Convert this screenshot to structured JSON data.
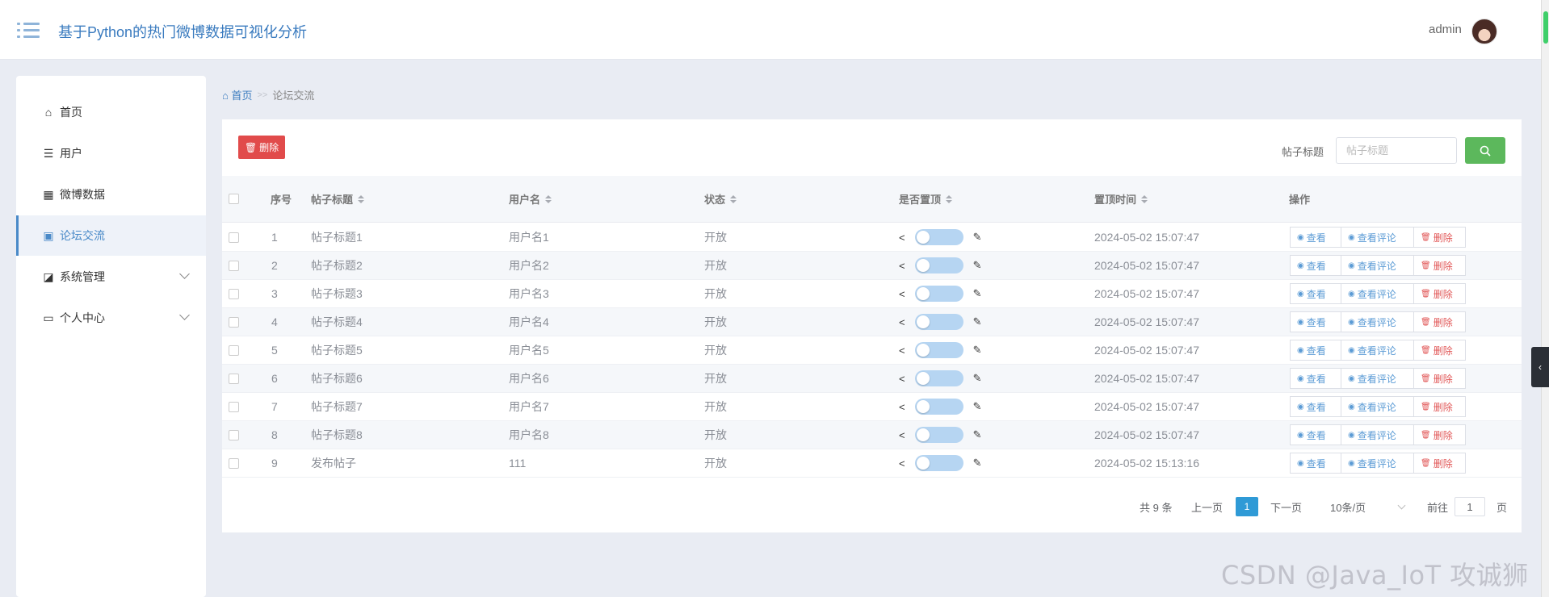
{
  "header": {
    "title": "基于Python的热门微博数据可视化分析",
    "user": "admin"
  },
  "sidebar": {
    "items": [
      {
        "label": "首页",
        "icon": "home-icon",
        "glyph": "⌂"
      },
      {
        "label": "用户",
        "icon": "sliders-icon",
        "glyph": "☰"
      },
      {
        "label": "微博数据",
        "icon": "grid-icon",
        "glyph": "▦"
      },
      {
        "label": "论坛交流",
        "icon": "clipboard-icon",
        "glyph": "▣"
      },
      {
        "label": "系统管理",
        "icon": "chart-icon",
        "glyph": "◪"
      },
      {
        "label": "个人中心",
        "icon": "wallet-icon",
        "glyph": "▭"
      }
    ],
    "active_index": 3
  },
  "breadcrumb": {
    "home": "首页",
    "sep": ">>",
    "current": "论坛交流"
  },
  "toolbar": {
    "delete_label": "删除",
    "search_label": "帖子标题",
    "search_placeholder": "帖子标题",
    "search_value": ""
  },
  "table": {
    "headers": {
      "index": "序号",
      "title": "帖子标题",
      "user": "用户名",
      "status": "状态",
      "pinned": "是否置顶",
      "pin_time": "置顶时间",
      "actions": "操作"
    },
    "rows": [
      {
        "index": "1",
        "title": "帖子标题1",
        "user": "用户名1",
        "status": "开放",
        "pinned": false,
        "pin_time": "2024-05-02 15:07:47"
      },
      {
        "index": "2",
        "title": "帖子标题2",
        "user": "用户名2",
        "status": "开放",
        "pinned": false,
        "pin_time": "2024-05-02 15:07:47"
      },
      {
        "index": "3",
        "title": "帖子标题3",
        "user": "用户名3",
        "status": "开放",
        "pinned": false,
        "pin_time": "2024-05-02 15:07:47"
      },
      {
        "index": "4",
        "title": "帖子标题4",
        "user": "用户名4",
        "status": "开放",
        "pinned": false,
        "pin_time": "2024-05-02 15:07:47"
      },
      {
        "index": "5",
        "title": "帖子标题5",
        "user": "用户名5",
        "status": "开放",
        "pinned": false,
        "pin_time": "2024-05-02 15:07:47"
      },
      {
        "index": "6",
        "title": "帖子标题6",
        "user": "用户名6",
        "status": "开放",
        "pinned": false,
        "pin_time": "2024-05-02 15:07:47"
      },
      {
        "index": "7",
        "title": "帖子标题7",
        "user": "用户名7",
        "status": "开放",
        "pinned": false,
        "pin_time": "2024-05-02 15:07:47"
      },
      {
        "index": "8",
        "title": "帖子标题8",
        "user": "用户名8",
        "status": "开放",
        "pinned": false,
        "pin_time": "2024-05-02 15:07:47"
      },
      {
        "index": "9",
        "title": "发布帖子",
        "user": "111",
        "status": "开放",
        "pinned": false,
        "pin_time": "2024-05-02 15:13:16"
      }
    ],
    "action_labels": {
      "view": "查看",
      "comments": "查看评论",
      "delete": "删除"
    }
  },
  "pagination": {
    "total": "共 9 条",
    "prev": "上一页",
    "current": "1",
    "next": "下一页",
    "page_size": "10条/页",
    "goto_label": "前往",
    "goto_value": "1",
    "page_unit": "页"
  },
  "watermark": "CSDN @Java_IoT 攻诚狮",
  "colors": {
    "accent": "#3a7bbf",
    "danger": "#e14b4b",
    "success": "#5cb85c",
    "page_active": "#2f9ad6"
  }
}
